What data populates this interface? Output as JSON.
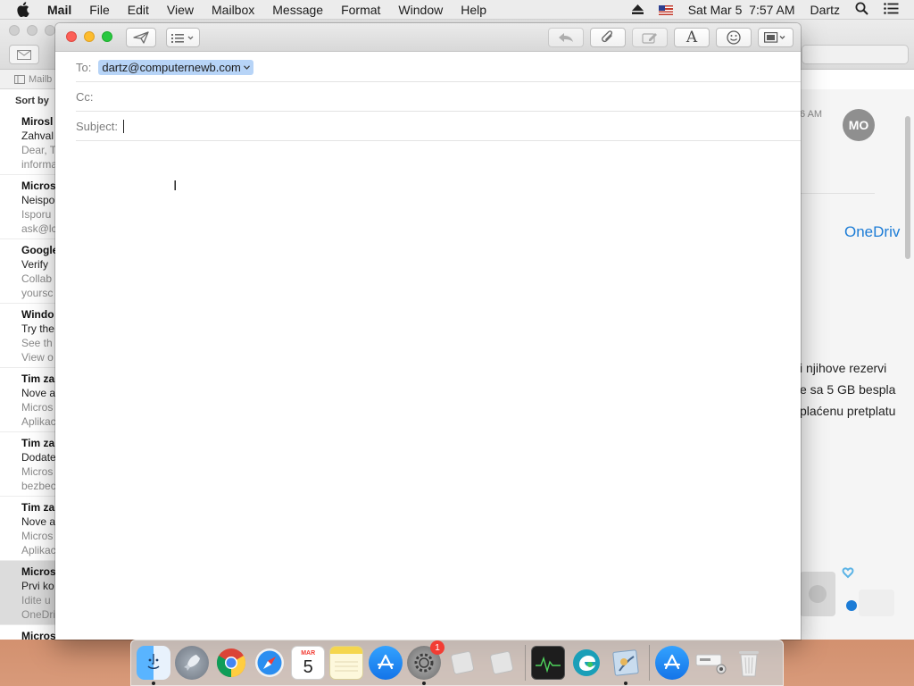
{
  "menubar": {
    "app_name": "Mail",
    "items": [
      "File",
      "Edit",
      "View",
      "Mailbox",
      "Message",
      "Format",
      "Window",
      "Help"
    ],
    "clock": "Sat Mar 5  7:57 AM",
    "user": "Dartz",
    "icons": [
      "apple-icon",
      "eject-icon",
      "us-flag-icon",
      "spotlight-search-icon",
      "control-center-icon"
    ]
  },
  "background_mail": {
    "sidebar_tab": "Mailb",
    "sort_label": "Sort by",
    "messages": [
      {
        "sender": "Mirosl",
        "subject": "Zahval",
        "preview1": "Dear, T",
        "preview2": "informa"
      },
      {
        "sender": "Micros",
        "subject": "Neispo",
        "preview1": "Isporu",
        "preview2": "ask@lc"
      },
      {
        "sender": "Google",
        "subject": "Verify",
        "preview1": "Collab",
        "preview2": "yoursc"
      },
      {
        "sender": "Windo",
        "subject": "Try the",
        "preview1": "See th",
        "preview2": "View o"
      },
      {
        "sender": "Tim za",
        "subject": "Nove a",
        "preview1": "Micros",
        "preview2": "Aplikac"
      },
      {
        "sender": "Tim za",
        "subject": "Dodate",
        "preview1": "Micros",
        "preview2": "bezbec"
      },
      {
        "sender": "Tim za",
        "subject": "Nove a",
        "preview1": "Micros",
        "preview2": "Aplikac"
      },
      {
        "sender": "Micros",
        "subject": "Prvi ko",
        "preview1": "Idite u",
        "preview2": "OneDri"
      },
      {
        "sender": "Micros",
        "subject": "",
        "preview1": "",
        "preview2": ""
      }
    ],
    "reader": {
      "time": "6 AM",
      "avatar_initials": "MO",
      "link_text": "OneDriv",
      "body_lines": [
        "i njihove rezervi",
        "e sa 5 GB bespla",
        "plaćenu pretplatu"
      ]
    }
  },
  "compose": {
    "to_label": "To:",
    "to_recipient": "dartz@computernewb.com",
    "cc_label": "Cc:",
    "subject_label": "Subject:",
    "subject_value": "",
    "toolbar_icons": [
      "send-icon",
      "header-fields-icon",
      "reply-icon",
      "attach-icon",
      "markup-icon",
      "format-fonts-icon",
      "emoji-icon",
      "photo-browser-icon"
    ]
  },
  "dock": {
    "items": [
      {
        "name": "finder-icon",
        "color": "#2d8ff0",
        "running": true
      },
      {
        "name": "launchpad-icon",
        "color": "#7b8592",
        "running": false
      },
      {
        "name": "chrome-icon",
        "color": "#ffffff",
        "running": false
      },
      {
        "name": "safari-icon",
        "color": "#1e88e5",
        "running": false
      },
      {
        "name": "calendar-icon",
        "color": "#ffffff",
        "running": false,
        "month": "MAR",
        "day": "5"
      },
      {
        "name": "notes-icon",
        "color": "#f7e27a",
        "running": false
      },
      {
        "name": "app-store-icon",
        "color": "#1a8cf3",
        "running": false
      },
      {
        "name": "system-preferences-icon",
        "color": "#808080",
        "running": true,
        "badge": "1"
      },
      {
        "name": "generic-app-icon",
        "color": "#dddddd",
        "running": false
      },
      {
        "name": "generic-app-icon-2",
        "color": "#dddddd",
        "running": false
      },
      {
        "name": "activity-monitor-icon",
        "color": "#222222",
        "running": false
      },
      {
        "name": "edge-icon",
        "color": "#1a9fb8",
        "running": false
      },
      {
        "name": "mail-icon",
        "color": "#9fc0e0",
        "running": true
      },
      {
        "name": "app-store-downloads-icon",
        "color": "#1a8cf3",
        "running": false
      },
      {
        "name": "documents-stack-icon",
        "color": "#f2f2f2",
        "running": false
      },
      {
        "name": "trash-icon",
        "color": "#e8e8e8",
        "running": false
      }
    ]
  }
}
